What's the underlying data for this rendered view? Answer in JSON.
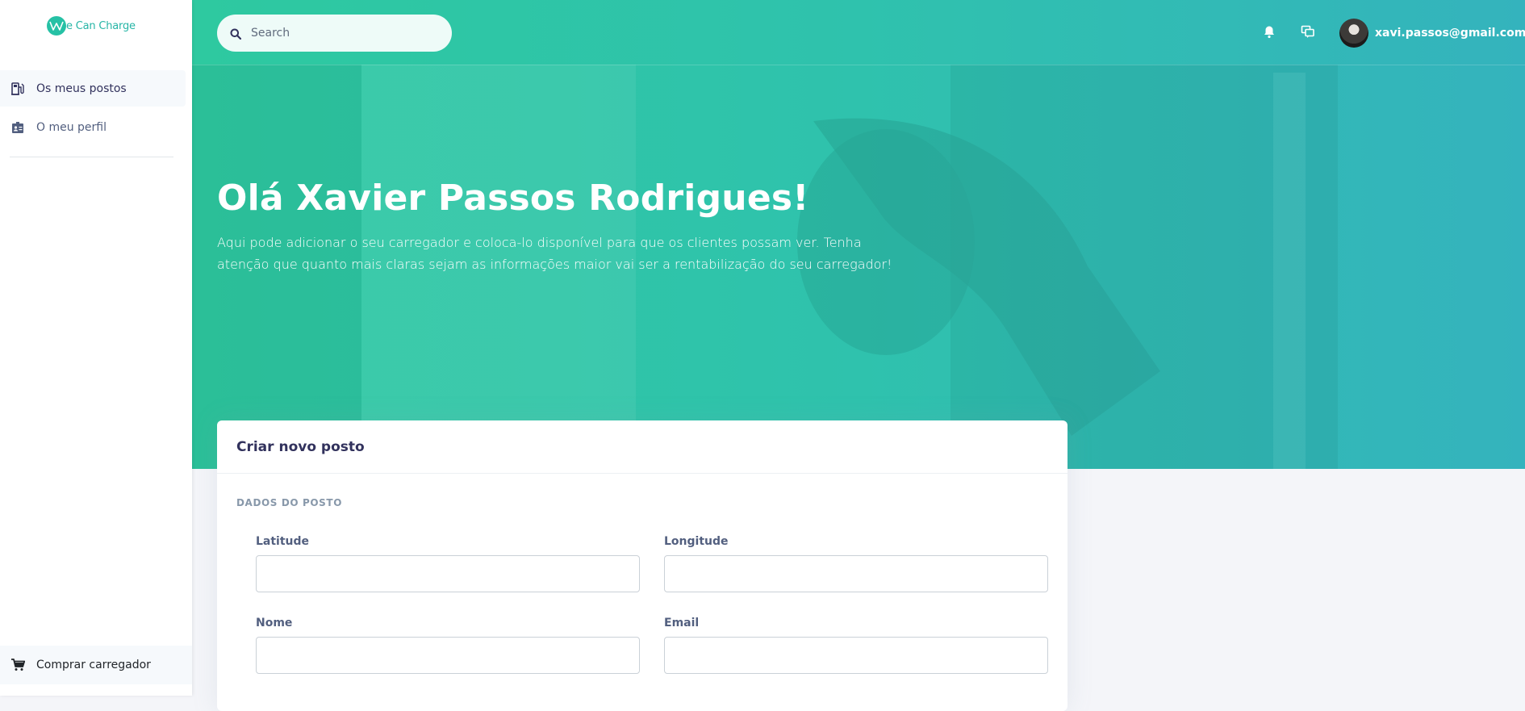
{
  "sidebar": {
    "logo_text": "e Can Charge",
    "items": [
      {
        "label": "Os meus postos",
        "icon": "charging-station-icon",
        "active": true
      },
      {
        "label": "O meu perfil",
        "icon": "id-card-icon",
        "active": false
      }
    ],
    "bottom_item": {
      "label": "Comprar carregador",
      "icon": "cart-icon"
    }
  },
  "topbar": {
    "search_placeholder": "Search",
    "user_email": "xavi.passos@gmail.com"
  },
  "hero": {
    "greeting": "Olá Xavier Passos Rodrigues!",
    "intro": "Aqui pode adicionar o seu carregador e coloca-lo disponível para que os clientes possam ver. Tenha atenção que quanto mais claras sejam as informações maior vai ser a rentabilização do seu carregador!"
  },
  "form": {
    "title": "Criar novo posto",
    "section": "DADOS DO POSTO",
    "fields": [
      {
        "label": "Latitude",
        "value": ""
      },
      {
        "label": "Longitude",
        "value": ""
      },
      {
        "label": "Nome",
        "value": ""
      },
      {
        "label": "Email",
        "value": ""
      }
    ]
  },
  "colors": {
    "accent": "#2ec9a0",
    "accent_end": "#34b3bd",
    "text_dark": "#32325d",
    "text_muted": "#8898aa"
  }
}
